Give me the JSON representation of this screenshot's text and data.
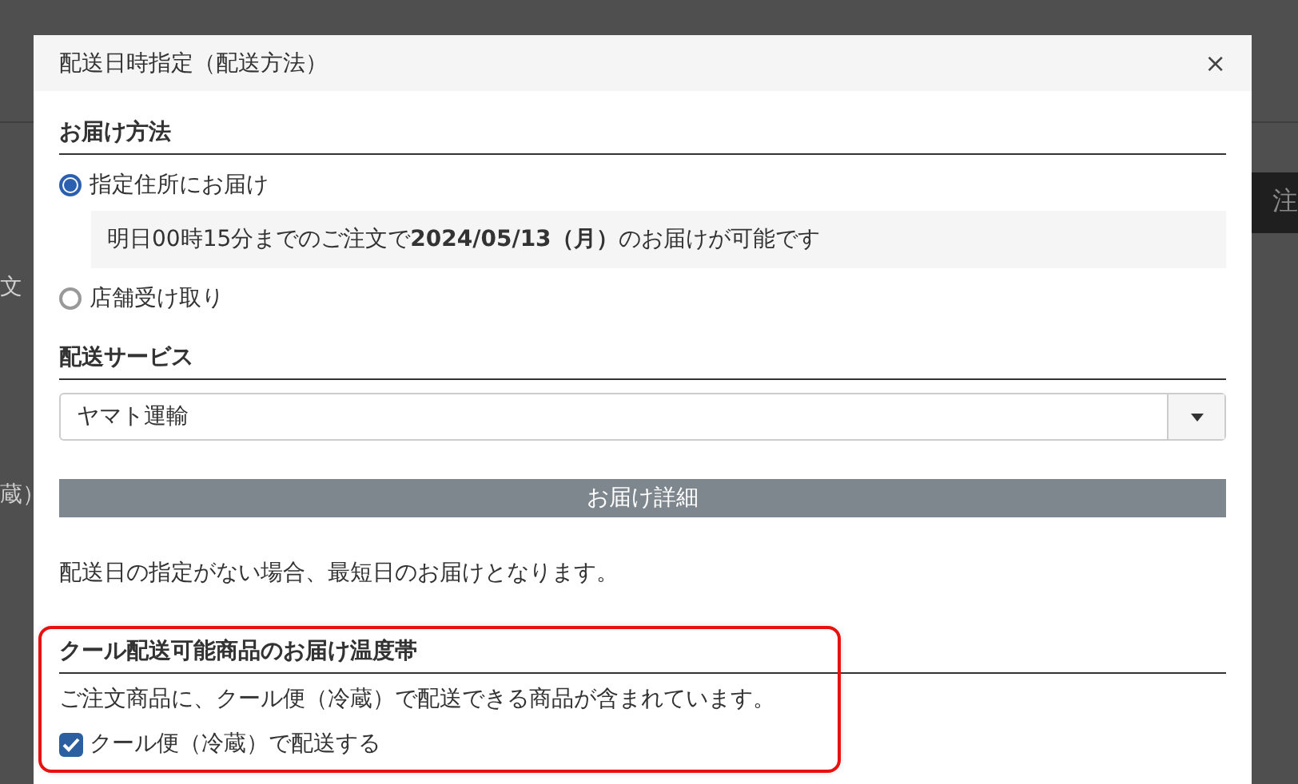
{
  "background": {
    "fragments": [
      {
        "text": "文"
      },
      {
        "text": "蔵）"
      },
      {
        "text": "注"
      }
    ]
  },
  "dialog": {
    "title": "配送日時指定（配送方法）",
    "close": "×"
  },
  "delivery_method": {
    "heading": "お届け方法",
    "options": [
      {
        "label": "指定住所にお届け",
        "selected": true,
        "note": "明日00時15分までのご注文で**2024/05/13（月）**のお届けが可能です"
      },
      {
        "label": "店舗受け取り",
        "selected": false
      }
    ]
  },
  "delivery_service": {
    "heading": "配送サービス",
    "select": {
      "value": "ヤマト運輸"
    }
  },
  "details_bar": {
    "label": "お届け詳細"
  },
  "notice": "配送日の指定がない場合、最短日のお届けとなります。",
  "cool_delivery": {
    "highlighted": true,
    "heading": "クール配送可能商品のお届け温度帯",
    "text": "ご注文商品に、クール便（冷蔵）で配送できる商品が含まれています。",
    "checkbox": {
      "label": "クール便（冷蔵）で配送する",
      "checked": true
    }
  }
}
